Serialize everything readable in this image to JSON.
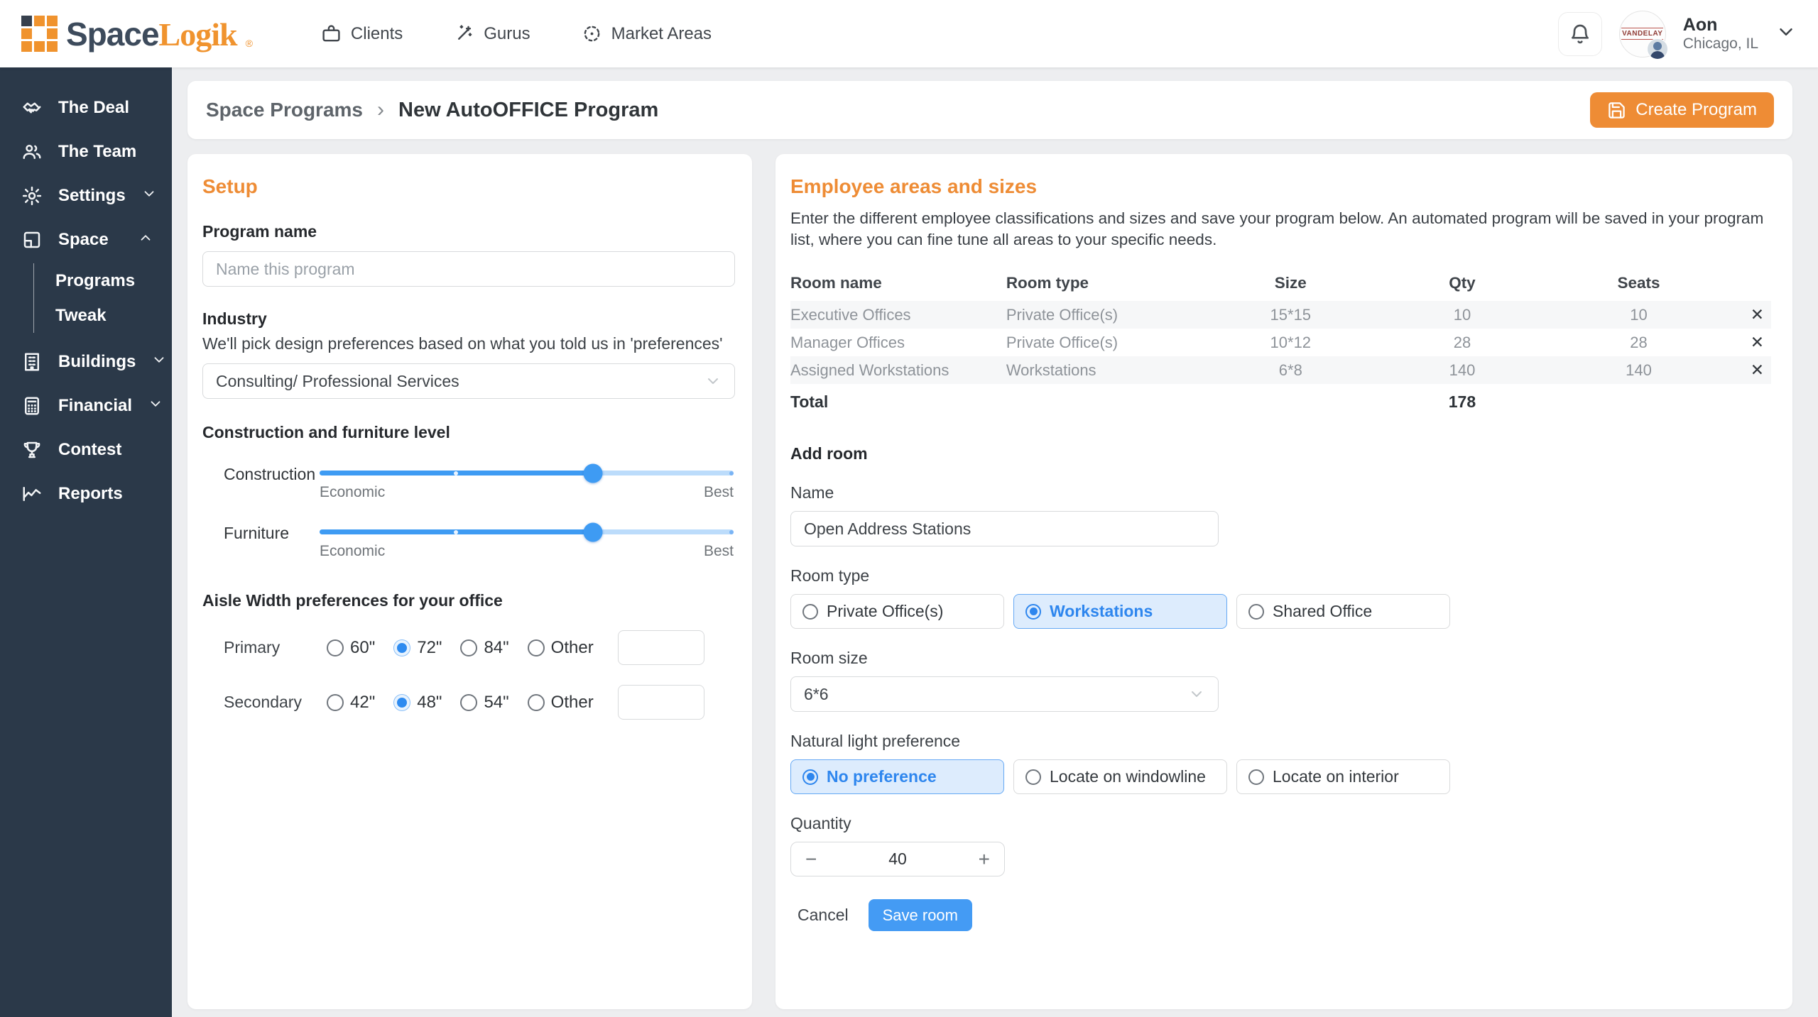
{
  "colors": {
    "accent_orange": "#ee8c35",
    "primary_blue": "#3e9bf3",
    "selected_light_blue": "#ddecfd",
    "sidebar_bg": "#2b3949",
    "page_bg": "#edeef0"
  },
  "icons": {
    "close": "✕",
    "breadcrumb_sep": "›",
    "minus": "−",
    "plus": "+"
  },
  "brand": {
    "name_primary": "Space",
    "name_secondary": "Logik",
    "trademark": "®"
  },
  "header": {
    "nav": [
      {
        "label": "Clients"
      },
      {
        "label": "Gurus"
      },
      {
        "label": "Market Areas"
      }
    ],
    "user": {
      "name": "Aon",
      "location": "Chicago, IL",
      "avatar_text": "VANDELAY"
    }
  },
  "sidebar": {
    "items": [
      {
        "label": "The Deal"
      },
      {
        "label": "The Team"
      },
      {
        "label": "Settings"
      },
      {
        "label": "Space",
        "children": [
          {
            "label": "Programs"
          },
          {
            "label": "Tweak"
          }
        ]
      },
      {
        "label": "Buildings"
      },
      {
        "label": "Financial"
      },
      {
        "label": "Contest"
      },
      {
        "label": "Reports"
      }
    ]
  },
  "breadcrumb": {
    "parent": "Space Programs",
    "current": "New AutoOFFICE Program"
  },
  "create_button": {
    "label": "Create Program"
  },
  "setup": {
    "title": "Setup",
    "program_name_label": "Program name",
    "program_name_placeholder": "Name this program",
    "industry_label": "Industry",
    "industry_help": "We'll pick design preferences based on what you told us in 'preferences'",
    "industry_value": "Consulting/ Professional Services",
    "construction_section_label": "Construction and furniture level",
    "sliders": [
      {
        "label": "Construction",
        "min_label": "Economic",
        "max_label": "Best",
        "value_pct": 66
      },
      {
        "label": "Furniture",
        "min_label": "Economic",
        "max_label": "Best",
        "value_pct": 66
      }
    ],
    "aisle_section_label": "Aisle Width preferences for your office",
    "aisle_rows": [
      {
        "label": "Primary",
        "options": [
          "60\"",
          "72\"",
          "84\"",
          "Other"
        ],
        "selected": "72\""
      },
      {
        "label": "Secondary",
        "options": [
          "42\"",
          "48\"",
          "54\"",
          "Other"
        ],
        "selected": "48\""
      }
    ]
  },
  "employee_panel": {
    "title": "Employee areas and sizes",
    "description": "Enter the different employee classifications and sizes and save your program below. An automated program will be saved in your program list, where you can fine tune all areas to your specific needs.",
    "table": {
      "headers": [
        "Room name",
        "Room type",
        "Size",
        "Qty",
        "Seats"
      ],
      "rows": [
        [
          "Executive Offices",
          "Private Office(s)",
          "15*15",
          "10",
          "10"
        ],
        [
          "Manager Offices",
          "Private Office(s)",
          "10*12",
          "28",
          "28"
        ],
        [
          "Assigned Workstations",
          "Workstations",
          "6*8",
          "140",
          "140"
        ]
      ],
      "total_label": "Total",
      "total_qty": "178"
    },
    "add_room": {
      "title": "Add room",
      "name_label": "Name",
      "name_value": "Open Address Stations",
      "room_type_label": "Room type",
      "room_type_options": [
        "Private Office(s)",
        "Workstations",
        "Shared Office"
      ],
      "room_type_selected": "Workstations",
      "room_size_label": "Room size",
      "room_size_value": "6*6",
      "light_label": "Natural light preference",
      "light_options": [
        "No preference",
        "Locate on windowline",
        "Locate on interior"
      ],
      "light_selected": "No preference",
      "quantity_label": "Quantity",
      "quantity_value": "40",
      "cancel_label": "Cancel",
      "save_label": "Save room"
    }
  }
}
